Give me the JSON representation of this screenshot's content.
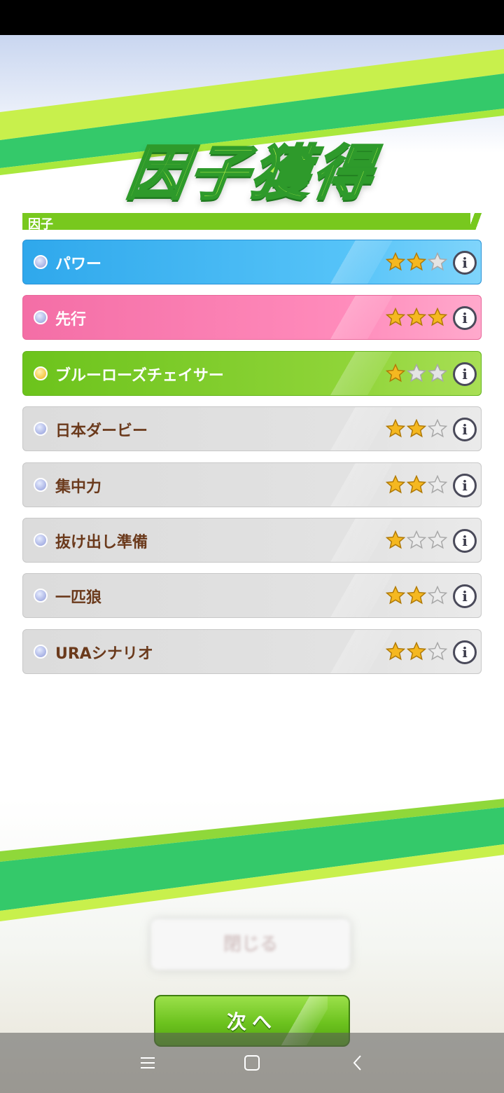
{
  "title": "因子獲得",
  "section_label": "因子",
  "factors": [
    {
      "name": "パワー",
      "color": "blue",
      "dot": "silver",
      "stars": 2,
      "max_stars": 3
    },
    {
      "name": "先行",
      "color": "pink",
      "dot": "silver",
      "stars": 3,
      "max_stars": 3
    },
    {
      "name": "ブルーローズチェイサー",
      "color": "green",
      "dot": "gold",
      "stars": 1,
      "max_stars": 3
    },
    {
      "name": "日本ダービー",
      "color": "gray",
      "dot": "silver",
      "stars": 2,
      "max_stars": 3
    },
    {
      "name": "集中力",
      "color": "gray",
      "dot": "silver",
      "stars": 2,
      "max_stars": 3
    },
    {
      "name": "抜け出し準備",
      "color": "gray",
      "dot": "silver",
      "stars": 1,
      "max_stars": 3
    },
    {
      "name": "一匹狼",
      "color": "gray",
      "dot": "silver",
      "stars": 2,
      "max_stars": 3
    },
    {
      "name": "URAシナリオ",
      "color": "gray",
      "dot": "silver",
      "stars": 2,
      "max_stars": 3
    }
  ],
  "info_label": "i",
  "blurred_button_label": "閉じる",
  "next_button_label": "次へ",
  "colors": {
    "accent_green": "#78c81e",
    "star_gold": "#f5b820",
    "text_brown": "#6b3a1c"
  },
  "nav_icons": [
    "menu-icon",
    "home-icon",
    "back-icon"
  ]
}
